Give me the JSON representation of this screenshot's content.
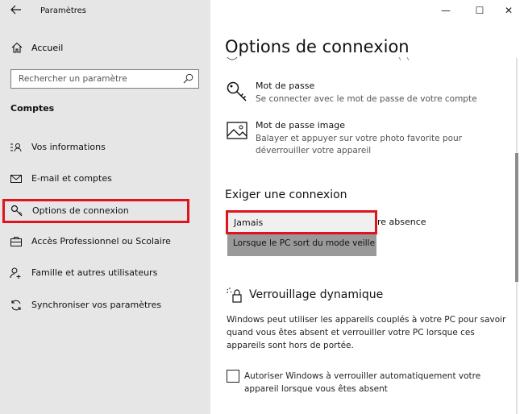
{
  "window": {
    "app_title": "Paramètres",
    "back_icon": "back-arrow-icon",
    "controls": {
      "minimize": "—",
      "maximize": "☐",
      "close": "✕"
    }
  },
  "sidebar": {
    "home_label": "Accueil",
    "search_placeholder": "Rechercher un paramètre",
    "section_title": "Comptes",
    "items": [
      {
        "label": "Vos informations",
        "icon": "user-info-icon"
      },
      {
        "label": "E-mail et comptes",
        "icon": "mail-icon"
      },
      {
        "label": "Options de connexion",
        "icon": "key-icon",
        "active": true
      },
      {
        "label": "Accès Professionnel ou Scolaire",
        "icon": "briefcase-icon"
      },
      {
        "label": "Famille et autres utilisateurs",
        "icon": "person-add-icon"
      },
      {
        "label": "Synchroniser vos paramètres",
        "icon": "sync-icon"
      }
    ]
  },
  "main": {
    "title": "Options de connexion",
    "options": [
      {
        "title": "Mot de passe",
        "desc": "Se connecter avec le mot de passe de votre compte",
        "icon": "key-icon"
      },
      {
        "title": "Mot de passe image",
        "desc": "Balayer et appuyer sur votre photo favorite pour déverrouiller votre appareil",
        "icon": "image-icon"
      }
    ],
    "require_signin": {
      "heading": "Exiger une connexion",
      "after_text": "re absence",
      "dropdown_selected": "Jamais",
      "dropdown_option": "Lorsque le PC sort du mode veille"
    },
    "dynamic_lock": {
      "heading": "Verrouillage dynamique",
      "description": "Windows peut utiliser les appareils couplés à votre PC pour savoir quand vous êtes absent et verrouiller votre PC lorsque ces appareils sont hors de portée.",
      "checkbox_label": "Autoriser Windows à verrouiller automatiquement votre appareil lorsque vous êtes absent",
      "checkbox_checked": false
    }
  },
  "colors": {
    "sidebar_bg": "#e6e6e6",
    "highlight_border": "#e0141e",
    "dropdown_option_bg": "#999999"
  }
}
